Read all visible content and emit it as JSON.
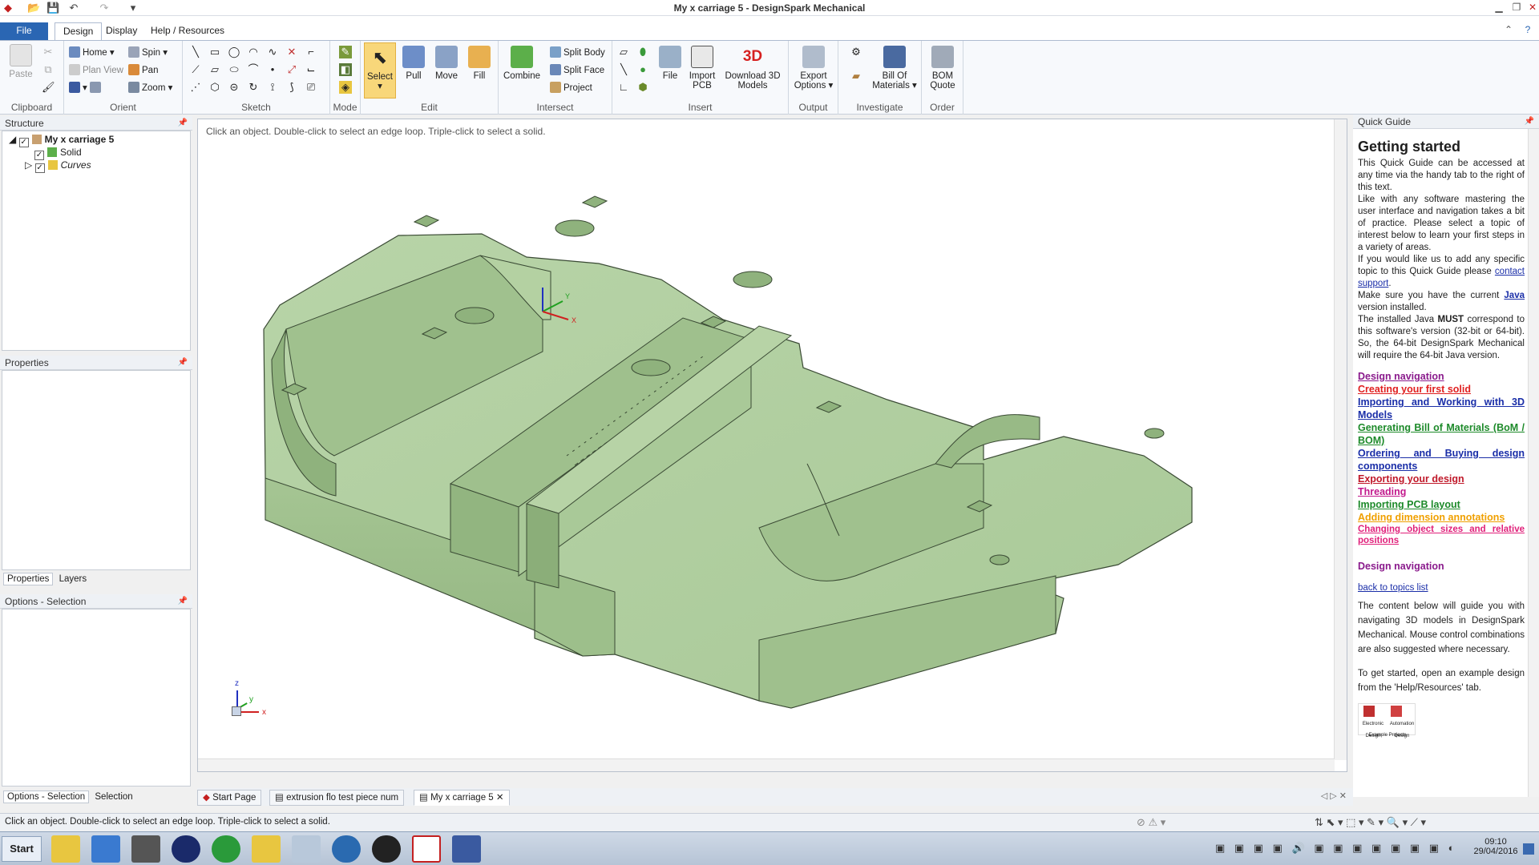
{
  "window": {
    "title": "My x carriage 5 - DesignSpark Mechanical"
  },
  "tabs": {
    "file": "File",
    "design": "Design",
    "display": "Display",
    "help": "Help / Resources"
  },
  "ribbon": {
    "clipboard": {
      "label": "Clipboard",
      "paste": "Paste"
    },
    "orient": {
      "label": "Orient",
      "home": "Home",
      "plan_view": "Plan View",
      "spin": "Spin",
      "pan": "Pan",
      "zoom": "Zoom"
    },
    "sketch": {
      "label": "Sketch"
    },
    "mode": {
      "label": "Mode"
    },
    "edit": {
      "label": "Edit",
      "select": "Select",
      "pull": "Pull",
      "move": "Move",
      "fill": "Fill"
    },
    "intersect": {
      "label": "Intersect",
      "combine": "Combine",
      "split_body": "Split Body",
      "split_face": "Split Face",
      "project": "Project"
    },
    "insert": {
      "label": "Insert",
      "file": "File",
      "import_pcb": "Import PCB",
      "download": "Download 3D Models"
    },
    "output": {
      "label": "Output",
      "export": "Export Options"
    },
    "investigate": {
      "label": "Investigate",
      "bom": "Bill Of Materials"
    },
    "order": {
      "label": "Order",
      "bom_quote": "BOM Quote"
    }
  },
  "structure": {
    "header": "Structure",
    "root": "My x carriage 5",
    "solid": "Solid",
    "curves": "Curves"
  },
  "properties": {
    "header": "Properties",
    "tab_properties": "Properties",
    "tab_layers": "Layers"
  },
  "options": {
    "header": "Options - Selection",
    "tab_options": "Options - Selection",
    "tab_selection": "Selection"
  },
  "viewport": {
    "hint": "Click an object. Double-click to select an edge loop. Triple-click to select a solid."
  },
  "triad": {
    "x": "x",
    "y": "y",
    "z": "z"
  },
  "doc_tabs": [
    "Start Page",
    "extrusion flo test piece num",
    "My x carriage 5"
  ],
  "status": {
    "text": "Click an object. Double-click to select an edge loop. Triple-click to select a solid."
  },
  "quick_guide": {
    "header": "Quick Guide",
    "title": "Getting started",
    "p1": "This Quick Guide can be accessed at any time via the handy tab to the right of this text.",
    "p2": "Like with any software mastering the user interface and navigation takes a bit of practice. Please select a topic of interest below to learn your first steps in a variety of areas.",
    "p3a": "If you would like us to add any specific topic to this Quick Guide please ",
    "p3link": "contact support",
    "p4a": "Make sure you have the current ",
    "p4link": "Java",
    "p4b": " version installed.",
    "p5a": "The installed Java ",
    "p5bold": "MUST",
    "p5b": " correspond to this software's version (32-bit or 64-bit). So, the 64-bit DesignSpark Mechanical will require the 64-bit Java version.",
    "links": [
      {
        "text": "Design navigation",
        "color": "#8a1a8c"
      },
      {
        "text": "Creating your first solid",
        "color": "#e02020"
      },
      {
        "text": "Importing and Working with 3D Models",
        "color": "#1a2ea8"
      },
      {
        "text": "Generating Bill of Materials (BoM / BOM)",
        "color": "#1d8a2a"
      },
      {
        "text": "Ordering and Buying design components",
        "color": "#1a2ea8"
      },
      {
        "text": "Exporting your design",
        "color": "#c0192a"
      },
      {
        "text": "Threading",
        "color": "#c2188c"
      },
      {
        "text": "Importing PCB layout",
        "color": "#1d8a2a"
      },
      {
        "text": "Adding dimension annotations",
        "color": "#f0a000"
      },
      {
        "text": "Changing object sizes and relative positions",
        "color": "#e0207a"
      }
    ],
    "section": "Design navigation",
    "back": "back to topics list",
    "s1": "The content below will guide you with navigating 3D models in DesignSpark Mechanical. Mouse control combinations are also suggested where necessary.",
    "s2": "To get started, open an example design from the 'Help/Resources' tab.",
    "thumb1": "Electronic Design",
    "thumb2": "Automation Design",
    "thumbcap": "Example Projects"
  },
  "taskbar": {
    "start": "Start",
    "time": "09:10",
    "date": "29/04/2016"
  }
}
